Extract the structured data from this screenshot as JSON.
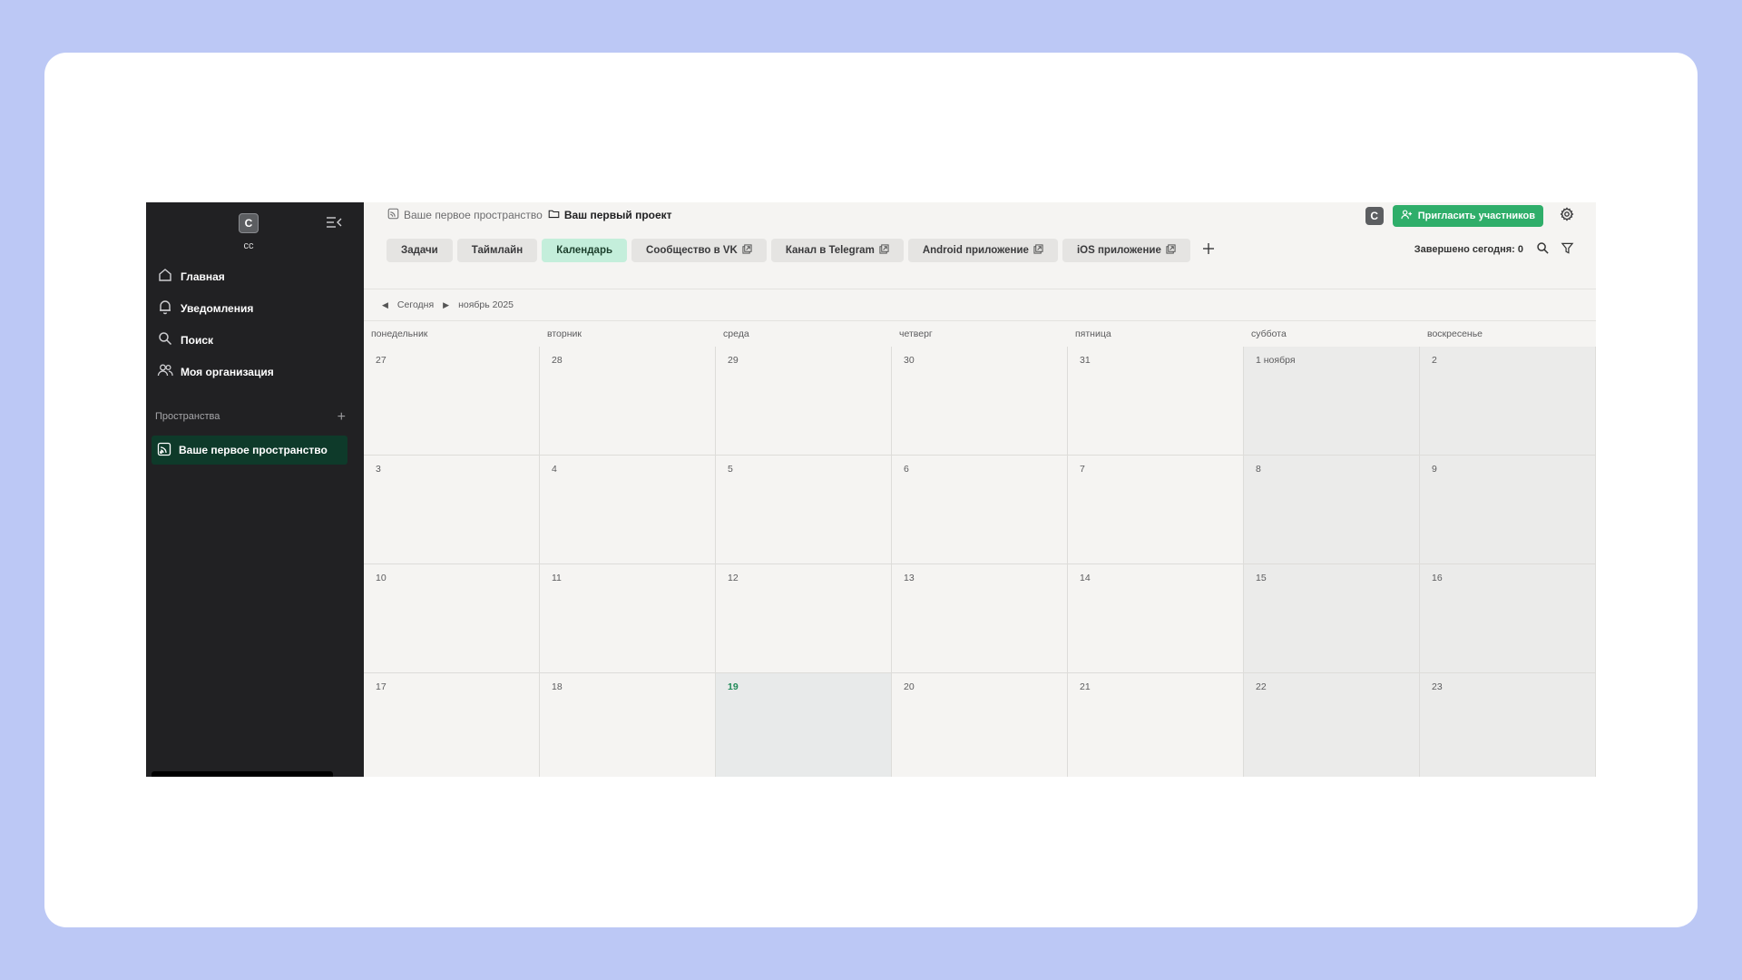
{
  "sidebar": {
    "avatar_letter": "C",
    "user_name": "сс",
    "nav": [
      {
        "label": "Главная",
        "icon": "home-icon"
      },
      {
        "label": "Уведомления",
        "icon": "bell-icon"
      },
      {
        "label": "Поиск",
        "icon": "search-icon"
      },
      {
        "label": "Моя организация",
        "icon": "people-icon"
      }
    ],
    "spaces_title": "Пространства",
    "space_item": "Ваше первое пространство"
  },
  "breadcrumb": {
    "space": "Ваше первое пространство",
    "project": "Ваш первый проект"
  },
  "header": {
    "user_badge": "C",
    "invite_label": "Пригласить участников",
    "done_today": "Завершено сегодня: 0"
  },
  "tabs": [
    {
      "label": "Задачи",
      "external": false,
      "active": false
    },
    {
      "label": "Таймлайн",
      "external": false,
      "active": false
    },
    {
      "label": "Календарь",
      "external": false,
      "active": true
    },
    {
      "label": "Сообщество в VK",
      "external": true,
      "active": false
    },
    {
      "label": "Канал в Telegram",
      "external": true,
      "active": false
    },
    {
      "label": "Android приложение",
      "external": true,
      "active": false
    },
    {
      "label": "iOS приложение",
      "external": true,
      "active": false
    }
  ],
  "calendar": {
    "today_label": "Сегодня",
    "month_label": "ноябрь 2025",
    "weekdays": [
      "понедельник",
      "вторник",
      "среда",
      "четверг",
      "пятница",
      "суббота",
      "воскресенье"
    ],
    "days": [
      "27",
      "28",
      "29",
      "30",
      "31",
      "1 ноября",
      "2",
      "3",
      "4",
      "5",
      "6",
      "7",
      "8",
      "9",
      "10",
      "11",
      "12",
      "13",
      "14",
      "15",
      "16",
      "17",
      "18",
      "19",
      "20",
      "21",
      "22",
      "23"
    ],
    "today": "19"
  },
  "colors": {
    "accent_green": "#2fae6a",
    "active_tab": "#c4eedb",
    "sidebar_bg": "#212123",
    "sidebar_active": "#0e3a2a"
  }
}
